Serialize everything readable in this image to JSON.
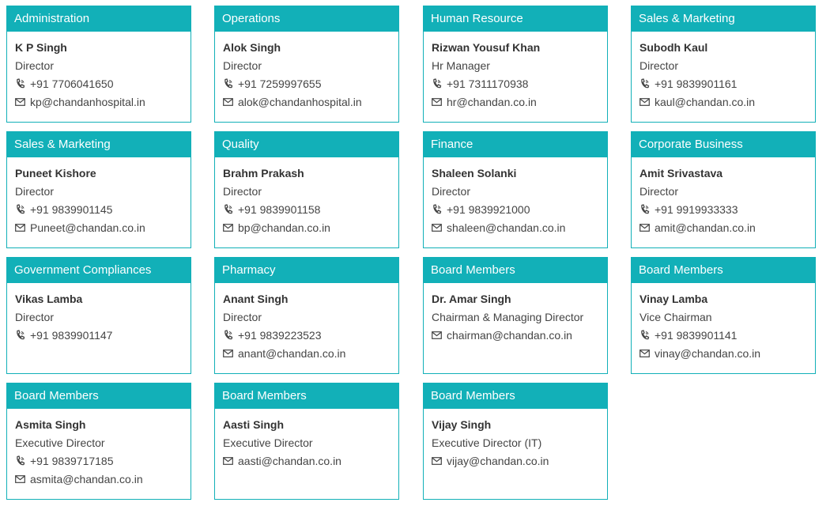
{
  "accent_color": "#12b0b8",
  "cards": [
    {
      "dept": "Administration",
      "name": "K P Singh",
      "title": "Director",
      "phone": "+91 7706041650",
      "email": "kp@chandanhospital.in"
    },
    {
      "dept": "Operations",
      "name": "Alok Singh",
      "title": "Director",
      "phone": "+91 7259997655",
      "email": "alok@chandanhospital.in"
    },
    {
      "dept": "Human Resource",
      "name": "Rizwan Yousuf Khan",
      "title": "Hr Manager",
      "phone": "+91 7311170938",
      "email": "hr@chandan.co.in"
    },
    {
      "dept": "Sales & Marketing",
      "name": "Subodh Kaul",
      "title": "Director",
      "phone": "+91 9839901161",
      "email": "kaul@chandan.co.in"
    },
    {
      "dept": "Sales & Marketing",
      "name": "Puneet Kishore",
      "title": "Director",
      "phone": "+91 9839901145",
      "email": "Puneet@chandan.co.in"
    },
    {
      "dept": "Quality",
      "name": "Brahm Prakash",
      "title": "Director",
      "phone": "+91 9839901158",
      "email": "bp@chandan.co.in"
    },
    {
      "dept": "Finance",
      "name": "Shaleen Solanki",
      "title": "Director",
      "phone": "+91 9839921000",
      "email": "shaleen@chandan.co.in"
    },
    {
      "dept": "Corporate Business",
      "name": "Amit Srivastava",
      "title": "Director",
      "phone": "+91 9919933333",
      "email": "amit@chandan.co.in"
    },
    {
      "dept": "Government Compliances",
      "name": "Vikas Lamba",
      "title": "Director",
      "phone": "+91 9839901147",
      "email": null
    },
    {
      "dept": "Pharmacy",
      "name": "Anant Singh",
      "title": "Director",
      "phone": "+91 9839223523",
      "email": "anant@chandan.co.in"
    },
    {
      "dept": "Board Members",
      "name": "Dr. Amar Singh",
      "title": "Chairman & Managing Director",
      "phone": null,
      "email": "chairman@chandan.co.in"
    },
    {
      "dept": "Board Members",
      "name": "Vinay Lamba",
      "title": "Vice Chairman",
      "phone": "+91 9839901141",
      "email": "vinay@chandan.co.in"
    },
    {
      "dept": "Board Members",
      "name": "Asmita Singh",
      "title": "Executive Director",
      "phone": "+91 9839717185",
      "email": "asmita@chandan.co.in"
    },
    {
      "dept": "Board Members",
      "name": "Aasti Singh",
      "title": "Executive Director",
      "phone": null,
      "email": "aasti@chandan.co.in"
    },
    {
      "dept": "Board Members",
      "name": "Vijay Singh",
      "title": "Executive Director (IT)",
      "phone": null,
      "email": "vijay@chandan.co.in"
    }
  ],
  "icons": {
    "phone": "phone-icon",
    "email": "envelope-icon"
  }
}
